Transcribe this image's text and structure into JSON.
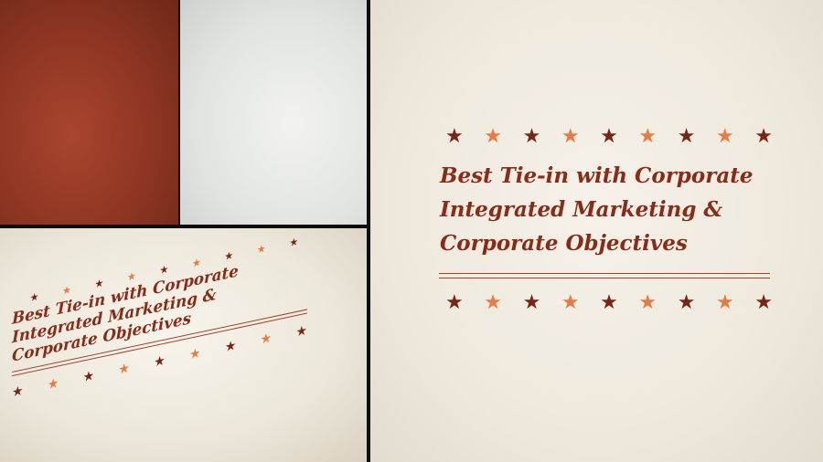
{
  "title_lines": [
    "Best Tie-in with Corporate",
    "Integrated Marketing &",
    "Corporate Objectives"
  ],
  "stars": [
    "dark",
    "light",
    "dark",
    "light",
    "dark",
    "light",
    "dark",
    "light",
    "dark"
  ],
  "colors": {
    "title": "#8a2b16",
    "star_dark": "#7a2412",
    "star_light": "#e87a42",
    "red_panel": "#8d3522",
    "grey_panel": "#e2e4e1",
    "paper": "#eee8dc"
  }
}
